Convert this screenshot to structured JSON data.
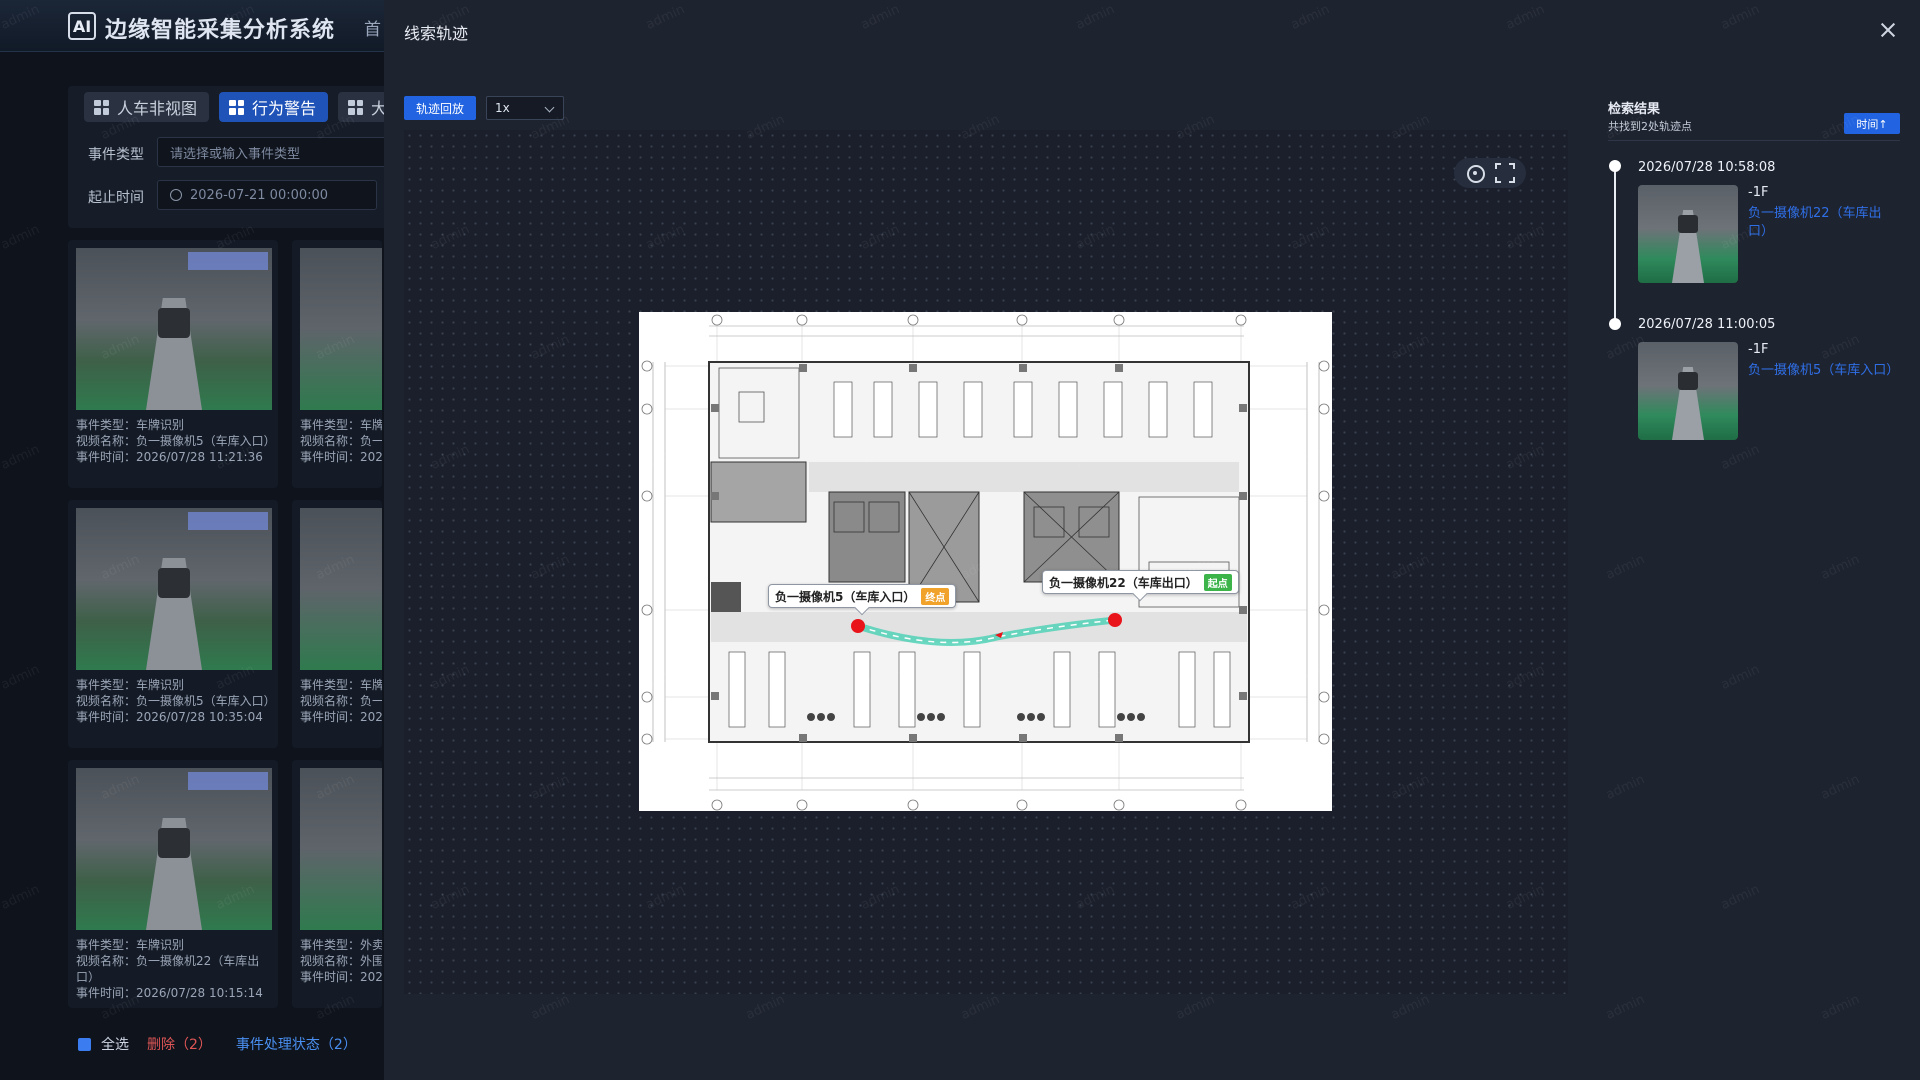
{
  "app": {
    "logo": "AI",
    "title": "边缘智能采集分析系统",
    "nav_first": "首"
  },
  "view_tabs": [
    {
      "label": "人车非视图"
    },
    {
      "label": "行为警告"
    },
    {
      "label": "大"
    }
  ],
  "filters": {
    "event_type_label": "事件类型",
    "event_type_placeholder": "请选择或输入事件类型",
    "time_label": "起止时间",
    "time_start": "2026-07-21 00:00:00"
  },
  "cards": [
    {
      "type": "事件类型：车牌识别",
      "video": "视频名称：负一摄像机5（车库入口）",
      "time": "事件时间：2026/07/28 11:21:36"
    },
    {
      "type": "事件类型：车牌识别",
      "video": "视频名称：负一摄像机5（车库入口）",
      "time": "事件时间：2026/07/28 10:35:04"
    },
    {
      "type": "事件类型：车牌识别",
      "video": "视频名称：负一摄像机22（车库出口）",
      "time": "事件时间：2026/07/28 10:15:14"
    }
  ],
  "cards_partial": [
    {
      "type": "事件类型：车牌",
      "video": "视频名称：负一",
      "time": "事件时间：202"
    },
    {
      "type": "事件类型：车牌",
      "video": "视频名称：负一",
      "time": "事件时间：202"
    },
    {
      "type": "事件类型：外卖",
      "video": "视频名称：外围",
      "time": "事件时间：202"
    }
  ],
  "bottom_bar": {
    "select_all": "全选",
    "delete": "删除（2）",
    "status": "事件处理状态（2）"
  },
  "modal": {
    "title": "线索轨迹",
    "replay_button": "轨迹回放",
    "speed": "1x"
  },
  "map": {
    "end_label": "负一摄像机5（车库入口）",
    "end_tag": "终点",
    "start_label": "负一摄像机22（车库出口）",
    "start_tag": "起点"
  },
  "results": {
    "title": "检索结果",
    "subtitle": "共找到2处轨迹点",
    "sort_button": "时间↑",
    "items": [
      {
        "time": "2026/07/28 10:58:08",
        "floor": "-1F",
        "camera": "负一摄像机22（车库出口）"
      },
      {
        "time": "2026/07/28 11:00:05",
        "floor": "-1F",
        "camera": "负一摄像机5（车库入口）"
      }
    ]
  },
  "watermark": "admin",
  "colors": {
    "accent": "#2163e0",
    "track": "#3ecfb0",
    "marker": "#e8141a",
    "danger": "#e05656"
  }
}
